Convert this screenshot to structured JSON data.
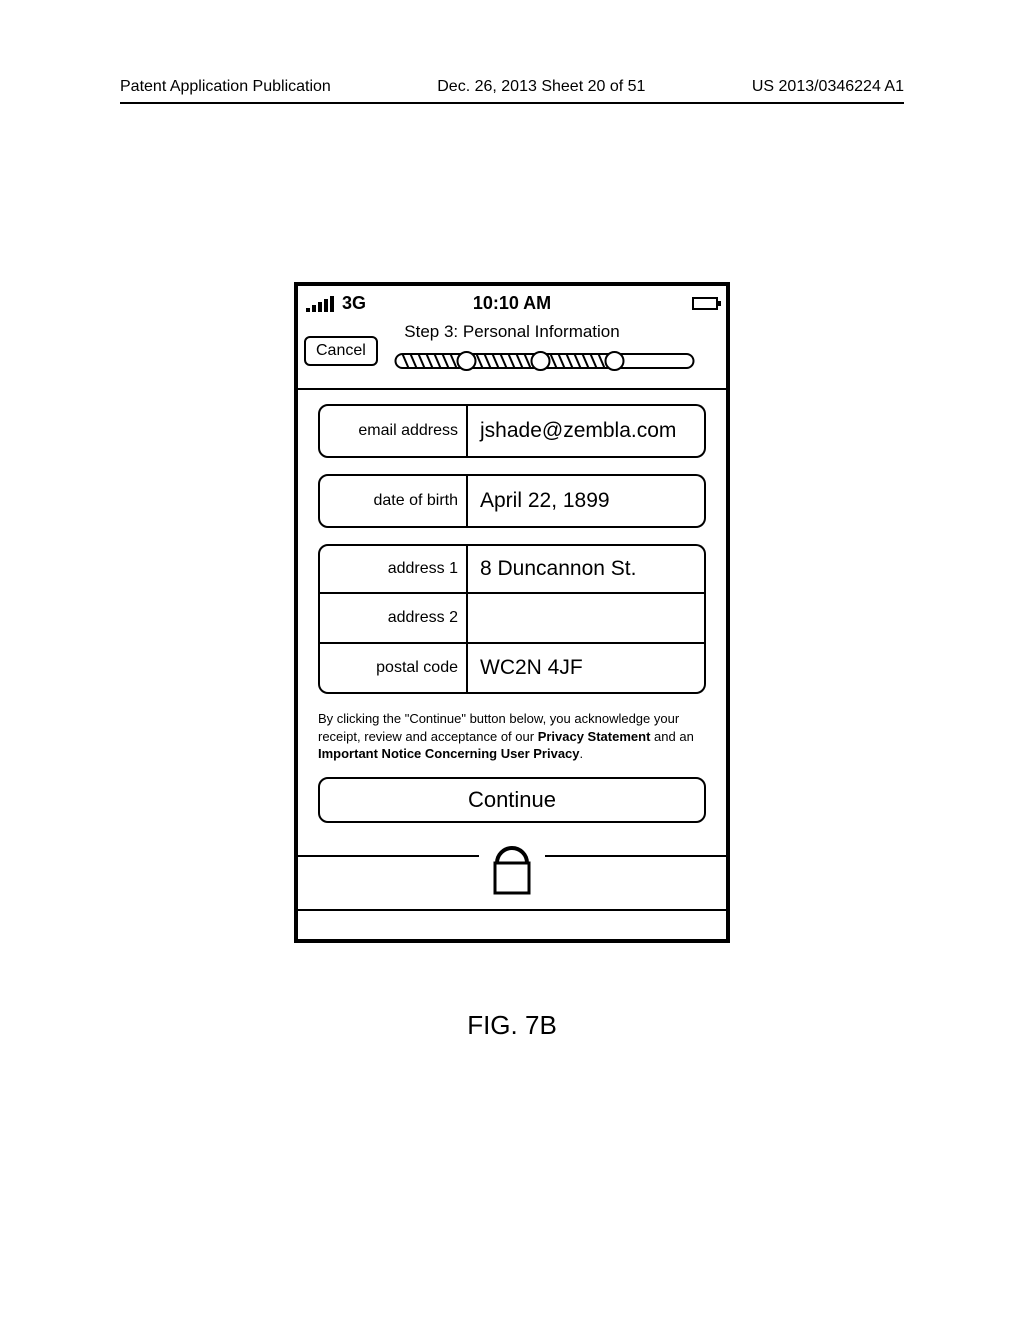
{
  "header": {
    "left": "Patent Application Publication",
    "center": "Dec. 26, 2013  Sheet 20 of 51",
    "right": "US 2013/0346224 A1"
  },
  "status": {
    "network": "3G",
    "time": "10:10 AM"
  },
  "nav": {
    "cancel": "Cancel",
    "title": "Step 3: Personal Information"
  },
  "fields": {
    "email_label": "email address",
    "email_value": "jshade@zembla.com",
    "dob_label": "date of birth",
    "dob_value": "April 22, 1899",
    "addr1_label": "address 1",
    "addr1_value": "8 Duncannon St.",
    "addr2_label": "address 2",
    "addr2_value": "",
    "postal_label": "postal code",
    "postal_value": "WC2N 4JF"
  },
  "disclaimer": {
    "pre": "By clicking the \"Continue\" button below, you acknowledge your receipt, review and acceptance of our ",
    "b1": "Privacy Statement",
    "mid": " and an ",
    "b2": "Important Notice Concerning User Privacy",
    "post": "."
  },
  "buttons": {
    "continue": "Continue"
  },
  "figure": "FIG. 7B"
}
